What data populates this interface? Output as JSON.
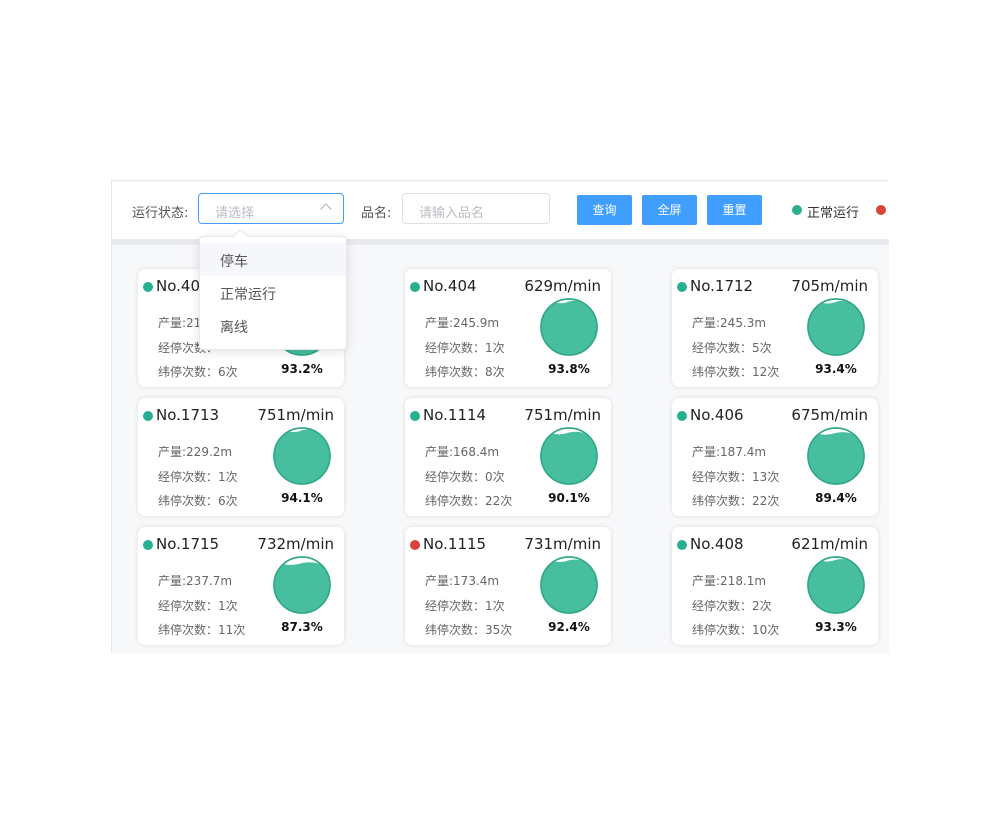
{
  "filters": {
    "status_label": "运行状态:",
    "status_placeholder": "请选择",
    "name_label": "品名:",
    "name_placeholder": "请输入品名"
  },
  "buttons": {
    "query": "查询",
    "fullscreen": "全屏",
    "reset": "重置"
  },
  "legend": [
    {
      "label": "正常运行",
      "color": "#26b08f"
    },
    {
      "label": "",
      "color": "#d9433a"
    }
  ],
  "dropdown": {
    "options": [
      "停车",
      "正常运行",
      "离线"
    ],
    "hovered_index": 0
  },
  "info_labels": {
    "output": "产量:",
    "warp": "经停次数：",
    "weft": "纬停次数："
  },
  "machines": [
    {
      "name": "No.403",
      "speed": "",
      "output": "21",
      "warp": "",
      "weft": "6次",
      "percent": "93.2%",
      "efficiency": 93.2,
      "status_color": "#26b08f"
    },
    {
      "name": "No.404",
      "speed": "629m/min",
      "output": "245.9m",
      "warp": "1次",
      "weft": "8次",
      "percent": "93.8%",
      "efficiency": 93.8,
      "status_color": "#26b08f"
    },
    {
      "name": "No.1712",
      "speed": "705m/min",
      "output": "245.3m",
      "warp": "5次",
      "weft": "12次",
      "percent": "93.4%",
      "efficiency": 93.4,
      "status_color": "#26b08f"
    },
    {
      "name": "No.1713",
      "speed": "751m/min",
      "output": "229.2m",
      "warp": "1次",
      "weft": "6次",
      "percent": "94.1%",
      "efficiency": 94.1,
      "status_color": "#26b08f"
    },
    {
      "name": "No.1114",
      "speed": "751m/min",
      "output": "168.4m",
      "warp": "0次",
      "weft": "22次",
      "percent": "90.1%",
      "efficiency": 90.1,
      "status_color": "#26b08f"
    },
    {
      "name": "No.406",
      "speed": "675m/min",
      "output": "187.4m",
      "warp": "13次",
      "weft": "22次",
      "percent": "89.4%",
      "efficiency": 89.4,
      "status_color": "#26b08f"
    },
    {
      "name": "No.1715",
      "speed": "732m/min",
      "output": "237.7m",
      "warp": "1次",
      "weft": "11次",
      "percent": "87.3%",
      "efficiency": 87.3,
      "status_color": "#26b08f"
    },
    {
      "name": "No.1115",
      "speed": "731m/min",
      "output": "173.4m",
      "warp": "1次",
      "weft": "35次",
      "percent": "92.4%",
      "efficiency": 92.4,
      "status_color": "#d9433a"
    },
    {
      "name": "No.408",
      "speed": "621m/min",
      "output": "218.1m",
      "warp": "2次",
      "weft": "10次",
      "percent": "93.3%",
      "efficiency": 93.3,
      "status_color": "#26b08f"
    }
  ],
  "colors": {
    "accent": "#409eff",
    "gauge_fill": "#47bf9f",
    "gauge_border": "#2fa887",
    "normal": "#26b08f",
    "fault": "#d9433a"
  }
}
